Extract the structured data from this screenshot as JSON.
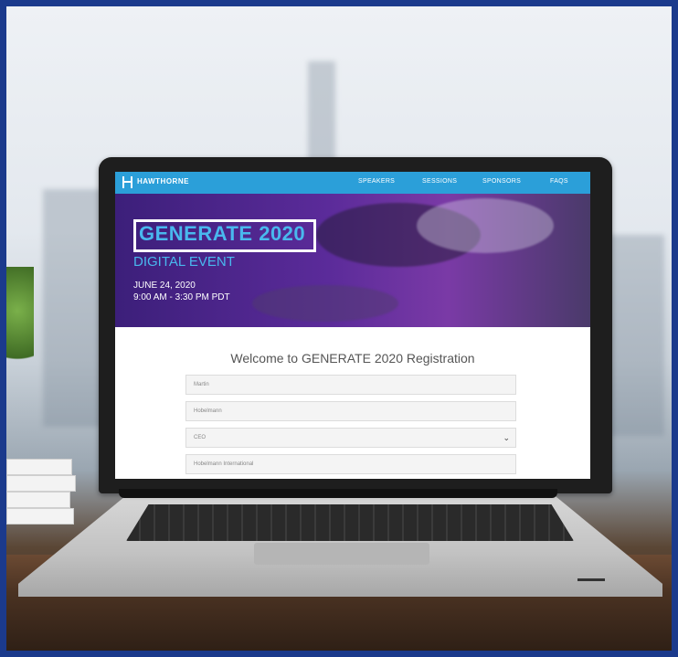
{
  "site": {
    "brand": "HAWTHORNE",
    "nav": [
      "SPEAKERS",
      "SESSIONS",
      "SPONSORS",
      "FAQS"
    ]
  },
  "hero": {
    "title": "GENERATE 2020",
    "subtitle": "DIGITAL EVENT",
    "date": "JUNE 24, 2020",
    "time": "9:00 AM - 3:30 PM PDT"
  },
  "registration": {
    "heading": "Welcome to GENERATE 2020 Registration",
    "fields": [
      {
        "value": "Martin"
      },
      {
        "value": "Hobelmann"
      },
      {
        "value": "CEO"
      },
      {
        "value": "Hobelmann International"
      }
    ]
  },
  "colors": {
    "frame": "#1b3a8c",
    "nav_bar": "#2b9fd9",
    "accent": "#49b8ee"
  }
}
